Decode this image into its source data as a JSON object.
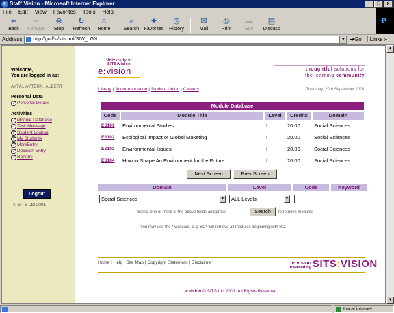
{
  "window": {
    "title": "Staff:Vision - Microsoft Internet Explorer",
    "min": "_",
    "max": "□",
    "close": "x"
  },
  "menu": [
    "File",
    "Edit",
    "View",
    "Favorites",
    "Tools",
    "Help"
  ],
  "toolbar": {
    "back": "Back",
    "forward": "Forward",
    "stop": "Stop",
    "refresh": "Refresh",
    "home": "Home",
    "search": "Search",
    "favorites": "Favorites",
    "history": "History",
    "mail": "Mail",
    "print": "Print",
    "edit": "Edit",
    "discuss": "Discuss"
  },
  "address": {
    "label": "Address",
    "url": "http://golf/si/sits.urd/SIW_LGN",
    "go": "Go",
    "links": "Links »"
  },
  "sidebar": {
    "welcome_line1": "Welcome,",
    "welcome_line2": "You are logged in as:",
    "user": "AYTA1 AYTERN, ALBERT",
    "personal_title": "Personal Data",
    "personal_items": [
      "Personal Details"
    ],
    "activities_title": "Activities",
    "activities": [
      "Module Database",
      "Task Message",
      "Student Lookup",
      "My Students",
      "MarkEntry",
      "Decision Entry",
      "Reports"
    ],
    "logout": "Logout",
    "copyright": "© SITS Ltd 2001"
  },
  "brand": {
    "university": "University of SITS:Vision",
    "e": "e:",
    "vision": "vision"
  },
  "tagline": {
    "line1_bold": "thoughtful",
    "line1": "solutions for",
    "line2": "the learning",
    "line2_bold": "community"
  },
  "top_links": [
    "Library",
    "Accommodation",
    "Student Union",
    "Careers"
  ],
  "date": "Thursday, 20th September 2001",
  "module_db": {
    "title": "Module Database",
    "columns": [
      "Code",
      "Module Title",
      "Level",
      "Credits",
      "Domain"
    ],
    "rows": [
      {
        "code": "ES101",
        "title": "Environmental Studies",
        "level": "I",
        "credits": "20.00",
        "domain": "Social Sciences"
      },
      {
        "code": "ES102",
        "title": "Ecological Impact of Global Maketing",
        "level": "I",
        "credits": "20.00",
        "domain": "Social Sciences"
      },
      {
        "code": "ES103",
        "title": "Environmental Issues",
        "level": "I",
        "credits": "20.00",
        "domain": "Social Sciences"
      },
      {
        "code": "ES104",
        "title": "How to Shape An Environment for the Future",
        "level": "I",
        "credits": "20.00",
        "domain": "Social Sciences"
      }
    ],
    "next": "Next Screen",
    "prev": "Prev Screen"
  },
  "search": {
    "headers": {
      "domain": "Domain",
      "level": "Level",
      "code": "Code",
      "keyword": "Keyword"
    },
    "domain_value": "Social Sciences",
    "level_value": "ALL Levels",
    "code_value": "",
    "keyword_value": "",
    "hint_before": "Select one or more of the above fields and press",
    "button": "Search",
    "hint_after": "to retrieve modules",
    "wildcard_hint": "You may use the * wildcard. e.g. BC* will retrieve all modules beginning with BC."
  },
  "footer": {
    "links": [
      "Home",
      "Help",
      "Site Map",
      "Copyright Statement",
      "Disclaimer"
    ],
    "ev": "e:vision",
    "powered": "powered by",
    "sits": "SITS",
    "sits_colon": ":",
    "sits_vision": "VISION",
    "copyright_bold": "e:vision",
    "copyright": "© SITS Ltd 2001. All Rights Reserved."
  },
  "status": {
    "zone": "Local intranet"
  }
}
